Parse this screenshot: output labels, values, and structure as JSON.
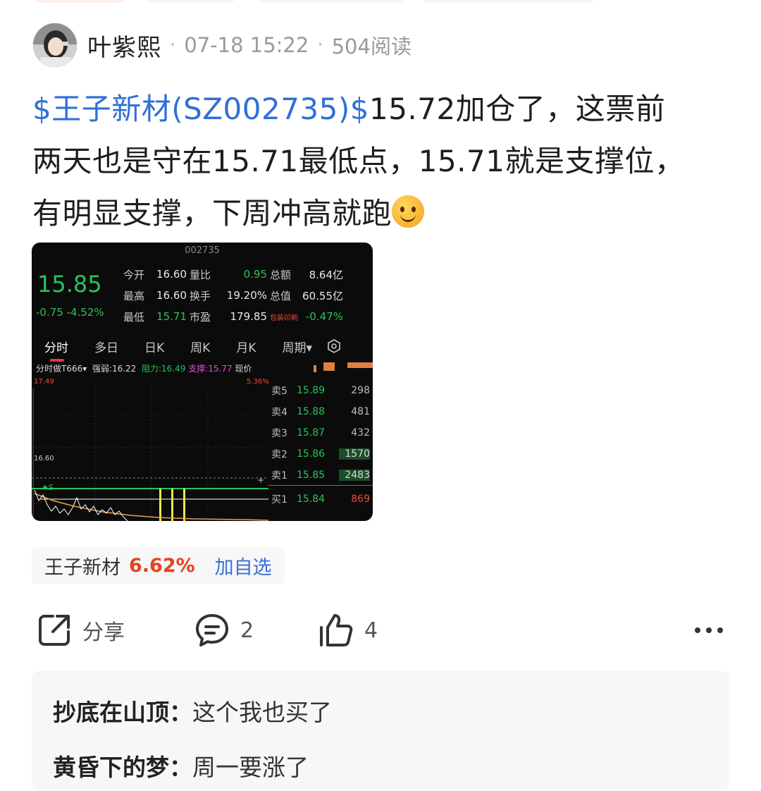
{
  "post": {
    "author": "叶紫熙",
    "time": "07-18 15:22",
    "reads": "504阅读",
    "stock_tag": "$王子新材(SZ002735)$",
    "text_line1": "15.72加仓了，这票前",
    "text_line2": "两天也是守在15.71最低点，15.71就是支撑位，",
    "text_line3": "有明显支撑，下周冲高就跑"
  },
  "quote_image": {
    "code": "002735",
    "price": "15.85",
    "change": "-0.75 -4.52%",
    "rows": [
      {
        "l1": "今开",
        "v1": "16.60",
        "l2": "量比",
        "v2": "0.95",
        "l3": "总额",
        "v3": "8.64亿"
      },
      {
        "l1": "最高",
        "v1": "16.60",
        "l2": "换手",
        "v2": "19.20%",
        "l3": "总值",
        "v3": "60.55亿"
      },
      {
        "l1": "最低",
        "v1": "15.71",
        "l2": "市盈",
        "v2": "179.85",
        "l3": "包装印刷",
        "v3": "-0.47%"
      }
    ],
    "tabs": [
      "分时",
      "多日",
      "日K",
      "周K",
      "月K",
      "周期▾"
    ],
    "indicator_name": "分时做T666▾",
    "strength": "强弱:16.22",
    "resistance": "阻力:16.49",
    "support": "支撑:15.77",
    "current": "现价",
    "high_price": "17.49",
    "high_pct": "5.36%",
    "open_price": "16.60",
    "order_book": [
      {
        "label": "卖5",
        "price": "15.89",
        "vol": "298"
      },
      {
        "label": "卖4",
        "price": "15.88",
        "vol": "481"
      },
      {
        "label": "卖3",
        "price": "15.87",
        "vol": "432"
      },
      {
        "label": "卖2",
        "price": "15.86",
        "vol": "1570"
      },
      {
        "label": "卖1",
        "price": "15.85",
        "vol": "2483"
      },
      {
        "label": "买1",
        "price": "15.84",
        "vol": "869"
      }
    ]
  },
  "stock_chip": {
    "name": "王子新材",
    "change": "6.62%",
    "action": "加自选"
  },
  "actions": {
    "share_label": "分享",
    "comment_count": "2",
    "like_count": "4"
  },
  "comments": [
    {
      "user": "抄底在山顶",
      "text": "这个我也买了"
    },
    {
      "user": "黄昏下的梦",
      "text": "周一要涨了"
    }
  ],
  "colors": {
    "link": "#2f6fd6",
    "up": "#e5431c",
    "quote_green": "#27c45a"
  }
}
